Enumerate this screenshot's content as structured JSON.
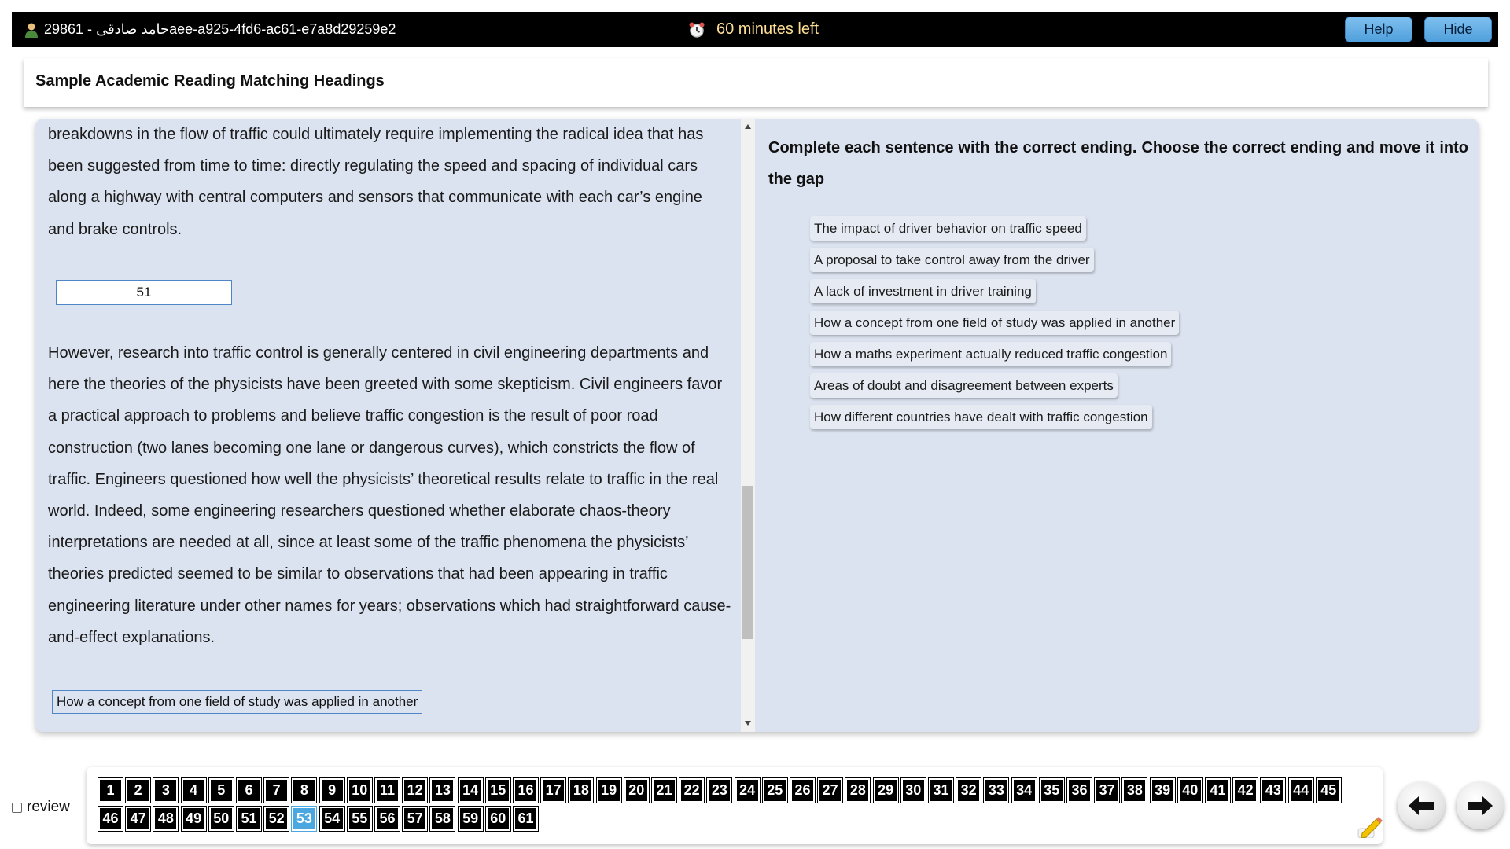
{
  "header": {
    "user_text": "29861 - حامد صادقی",
    "session_id": "aee-a925-4fd6-ac61-e7a8d29259e2",
    "timer_text": "60 minutes left",
    "help_label": "Help",
    "hide_label": "Hide",
    "timer_color": "#ffdf94"
  },
  "page": {
    "title": "Sample Academic Reading Matching Headings"
  },
  "passage": {
    "para1": "breakdowns in the flow of traffic could ultimately require implementing the radical idea that has been suggested from time to time: directly regulating the speed and spacing of individual cars along a highway with central computers and sensors that communicate with each car’s engine and brake controls.",
    "gap_value": "51",
    "para2": "However, research into traffic control is generally centered in civil engineering departments and here the theories of the physicists have been greeted with some skepticism. Civil engineers favor a practical approach to problems and believe traffic congestion is the result of poor road construction (two lanes becoming one lane or dangerous curves), which constricts the flow of traffic. Engineers questioned how well the physicists’ theoretical results relate to traffic in the real world. Indeed, some engineering researchers questioned whether elaborate chaos-theory interpretations are needed at all, since at least some of the traffic phenomena the physicists’ theories predicted seemed to be similar to observations that had been appearing in traffic engineering literature under other names for years; observations which had straightforward cause-and-effect explanations.",
    "dropped_answer": "How a concept from one field of study was applied in another"
  },
  "question": {
    "instructions": "Complete each sentence with the correct ending. Choose the correct ending and move it into the gap",
    "options": [
      "The impact of driver behavior on traffic speed",
      "A proposal to take control away from the driver",
      "A lack of investment in driver training",
      "How a concept from one field of study was applied in another",
      "How a maths experiment actually reduced traffic congestion",
      "Areas of doubt and disagreement between experts",
      "How different countries have dealt with traffic congestion"
    ]
  },
  "navigation": {
    "review_label": "review",
    "current_question": 53,
    "question_numbers": [
      "1",
      "2",
      "3",
      "4",
      "5",
      "6",
      "7",
      "8",
      "9",
      "10",
      "11",
      "12",
      "13",
      "14",
      "15",
      "16",
      "17",
      "18",
      "19",
      "20",
      "21",
      "22",
      "23",
      "24",
      "25",
      "26",
      "27",
      "28",
      "29",
      "30",
      "31",
      "32",
      "33",
      "34",
      "35",
      "36",
      "37",
      "38",
      "39",
      "40",
      "41",
      "42",
      "43",
      "44",
      "45",
      "46",
      "47",
      "48",
      "49",
      "50",
      "51",
      "52",
      "53",
      "54",
      "55",
      "56",
      "57",
      "58",
      "59",
      "60",
      "61"
    ],
    "accent_color": "#4aa7e0"
  }
}
